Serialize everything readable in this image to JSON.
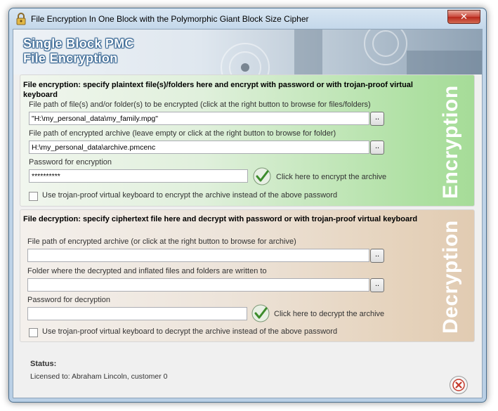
{
  "window": {
    "title": "File Encryption In One Block with the Polymorphic Giant Block Size Cipher",
    "close_label": "✕"
  },
  "banner": {
    "line1": "Single Block PMC",
    "line2": "File Encryption"
  },
  "encryption": {
    "heading": "File encryption: specify plaintext file(s)/folders here and encrypt with password or with trojan-proof virtual keyboard",
    "side_label": "Encryption",
    "source_label": "File path of file(s) and/or folder(s) to be encrypted (click at the right button to browse for files/folders)",
    "source_value": "\"H:\\my_personal_data\\my_family.mpg\"",
    "archive_label": "File path of encrypted archive (leave empty or click at the right button to browse for folder)",
    "archive_value": "H:\\my_personal_data\\archive.pmcenc",
    "password_label": "Password for encryption",
    "password_value": "**********",
    "action_label": "Click here to encrypt the archive",
    "keyboard_label": "Use trojan-proof virtual keyboard to encrypt the archive instead of the above password",
    "browse_label": ".."
  },
  "decryption": {
    "heading": "File decryption: specify ciphertext file here and decrypt with password or with trojan-proof virtual keyboard",
    "side_label": "Decryption",
    "archive_label": "File path of encrypted archive (or click at the right button to browse for archive)",
    "archive_value": "",
    "folder_label": "Folder where the decrypted and inflated files and folders are written to",
    "folder_value": "",
    "password_label": "Password for decryption",
    "password_value": "",
    "action_label": "Click here to decrypt the archive",
    "keyboard_label": "Use trojan-proof virtual keyboard to decrypt the archive instead of the above password",
    "browse_label": ".."
  },
  "status": {
    "label": "Status:",
    "license": "Licensed to: Abraham Lincoln, customer 0"
  },
  "icons": {
    "app": "lock-icon",
    "confirm": "checkmark-icon",
    "exit": "exit-icon"
  },
  "colors": {
    "encryption_accent": "#a6dc98",
    "decryption_accent": "#e1cbb2",
    "banner_text": "#ffffff"
  }
}
